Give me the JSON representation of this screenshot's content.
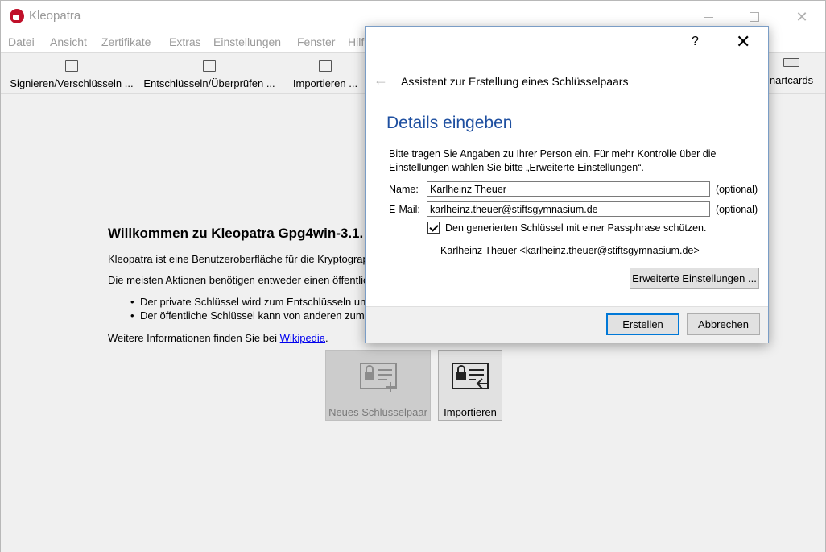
{
  "window": {
    "title": "Kleopatra",
    "controls": {
      "minimize": "minimize",
      "maximize": "maximize",
      "close": "✕"
    }
  },
  "menu": [
    "Datei",
    "Ansicht",
    "Zertifikate",
    "Extras",
    "Einstellungen",
    "Fenster",
    "Hilf"
  ],
  "toolbar": {
    "sign_encrypt": "Signieren/Verschlüsseln ...",
    "decrypt_verify": "Entschlüsseln/Überprüfen ...",
    "import": "Importieren ...",
    "smartcards": "nartcards"
  },
  "welcome": {
    "title": "Willkommen zu Kleopatra Gpg4win-3.1.",
    "line1": "Kleopatra ist eine Benutzeroberfläche für die Kryptograp",
    "line2": "Die meisten Aktionen benötigen entweder einen öffentlic",
    "bullet1": "Der private Schlüssel wird zum Entschlüsseln und",
    "bullet2": "Der öffentliche Schlüssel kann von anderen zum V",
    "more_info_prefix": "Weitere Informationen finden Sie bei ",
    "more_info_link": "Wikipedia",
    "more_info_suffix": ".",
    "new_keypair_label": "Neues Schlüsselpaar",
    "import_label": "Importieren"
  },
  "dialog": {
    "help": "?",
    "close": "✕",
    "back": "←",
    "title": "Assistent zur Erstellung eines Schlüsselpaars",
    "heading": "Details eingeben",
    "description": "Bitte tragen Sie Angaben zu Ihrer Person ein. Für mehr Kontrolle über die Einstellungen wählen Sie bitte „Erweiterte Einstellungen“.",
    "name_label": "Name:",
    "name_value": "Karlheinz Theuer",
    "name_optional": "(optional)",
    "email_label": "E-Mail:",
    "email_value": "karlheinz.theuer@stiftsgymnasium.de",
    "email_optional": "(optional)",
    "passphrase_label": "Den generierten Schlüssel mit einer Passphrase schützen.",
    "passphrase_checked": true,
    "uid_preview": "Karlheinz Theuer <karlheinz.theuer@stiftsgymnasium.de>",
    "advanced_button": "Erweiterte Einstellungen ...",
    "create_button": "Erstellen",
    "cancel_button": "Abbrechen"
  },
  "colors": {
    "heading_blue": "#1e4fa0",
    "app_red": "#c0102a",
    "default_button_border": "#0078d7",
    "link": "#0000ee"
  },
  "icons": [
    "kleopatra-logo-icon",
    "sign-encrypt-icon",
    "decrypt-verify-icon",
    "import-certificate-icon",
    "smartcard-icon",
    "back-arrow-icon",
    "new-keypair-icon",
    "import-keypair-icon",
    "checkmark-icon"
  ]
}
